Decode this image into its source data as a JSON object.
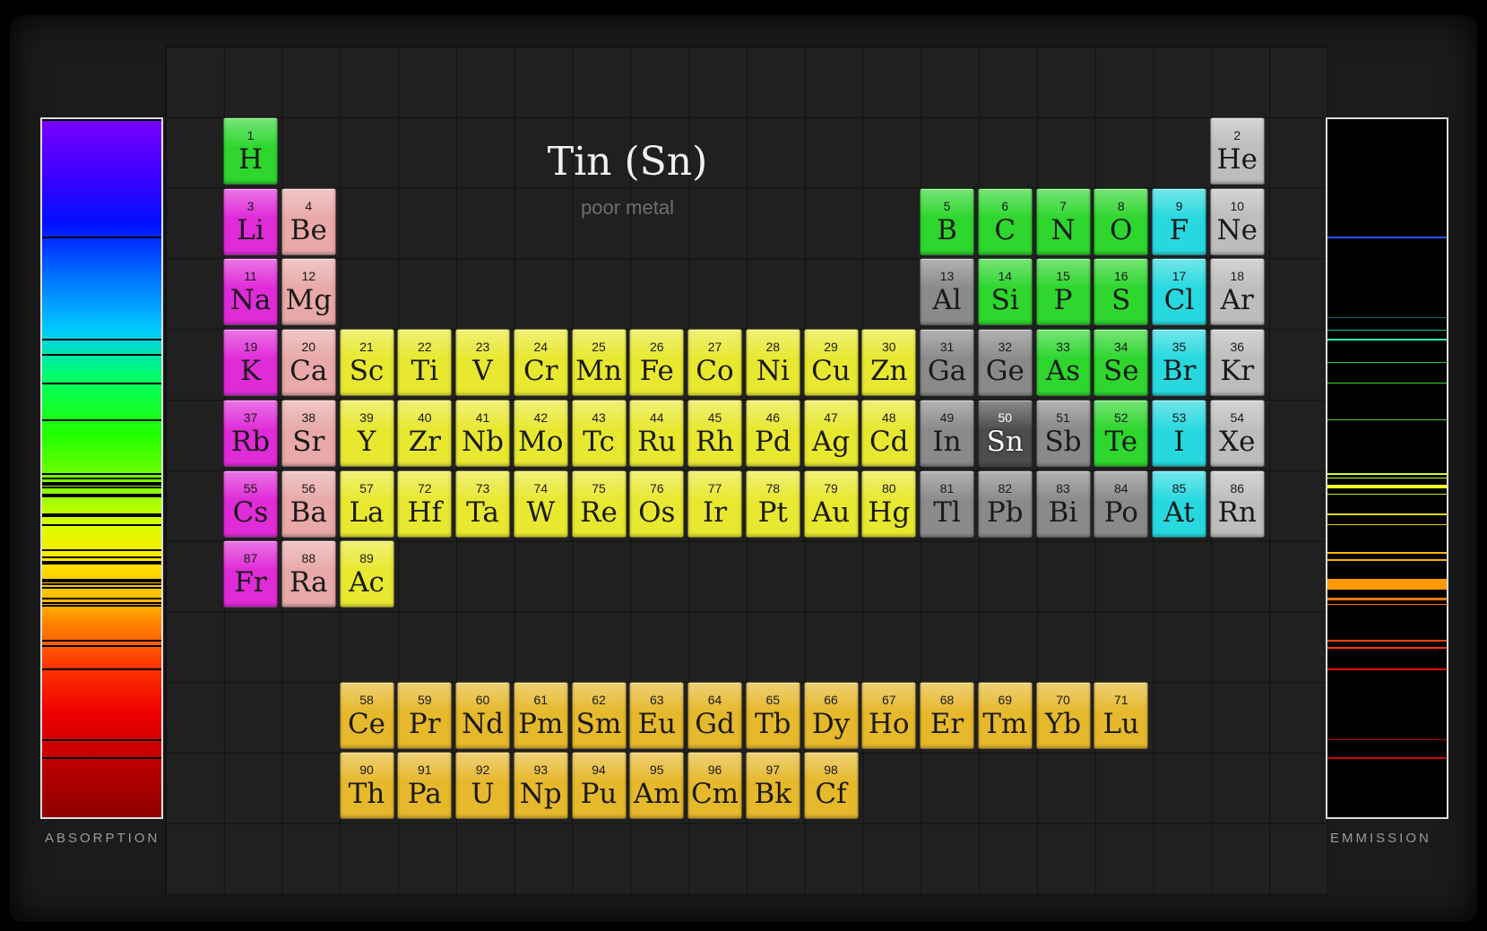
{
  "title": "Tin (Sn)",
  "subtitle": "poor metal",
  "absorption_label": "ABSORPTION",
  "emission_label": "EMMISSION",
  "colors": {
    "alkali": "#e02bd8",
    "alkaline": "#e8a9a8",
    "transition": "#e8e830",
    "nonmetal": "#2ed62e",
    "halogen": "#27d9df",
    "noble": "#bdbdbd",
    "poor": "#8a8a8a",
    "lanthanide": "#e6b82c",
    "actinide": "#e6b82c",
    "selected": "#4d4d4d"
  },
  "selected": "Sn",
  "elements": [
    {
      "n": "1",
      "s": "H",
      "t": "nonmetal",
      "r": 1,
      "c": 1
    },
    {
      "n": "2",
      "s": "He",
      "t": "noble",
      "r": 1,
      "c": 18
    },
    {
      "n": "3",
      "s": "Li",
      "t": "alkali",
      "r": 2,
      "c": 1
    },
    {
      "n": "4",
      "s": "Be",
      "t": "alkaline",
      "r": 2,
      "c": 2
    },
    {
      "n": "5",
      "s": "B",
      "t": "nonmetal",
      "r": 2,
      "c": 13
    },
    {
      "n": "6",
      "s": "C",
      "t": "nonmetal",
      "r": 2,
      "c": 14
    },
    {
      "n": "7",
      "s": "N",
      "t": "nonmetal",
      "r": 2,
      "c": 15
    },
    {
      "n": "8",
      "s": "O",
      "t": "nonmetal",
      "r": 2,
      "c": 16
    },
    {
      "n": "9",
      "s": "F",
      "t": "halogen",
      "r": 2,
      "c": 17
    },
    {
      "n": "10",
      "s": "Ne",
      "t": "noble",
      "r": 2,
      "c": 18
    },
    {
      "n": "11",
      "s": "Na",
      "t": "alkali",
      "r": 3,
      "c": 1
    },
    {
      "n": "12",
      "s": "Mg",
      "t": "alkaline",
      "r": 3,
      "c": 2
    },
    {
      "n": "13",
      "s": "Al",
      "t": "poor",
      "r": 3,
      "c": 13
    },
    {
      "n": "14",
      "s": "Si",
      "t": "nonmetal",
      "r": 3,
      "c": 14
    },
    {
      "n": "15",
      "s": "P",
      "t": "nonmetal",
      "r": 3,
      "c": 15
    },
    {
      "n": "16",
      "s": "S",
      "t": "nonmetal",
      "r": 3,
      "c": 16
    },
    {
      "n": "17",
      "s": "Cl",
      "t": "halogen",
      "r": 3,
      "c": 17
    },
    {
      "n": "18",
      "s": "Ar",
      "t": "noble",
      "r": 3,
      "c": 18
    },
    {
      "n": "19",
      "s": "K",
      "t": "alkali",
      "r": 4,
      "c": 1
    },
    {
      "n": "20",
      "s": "Ca",
      "t": "alkaline",
      "r": 4,
      "c": 2
    },
    {
      "n": "21",
      "s": "Sc",
      "t": "transition",
      "r": 4,
      "c": 3
    },
    {
      "n": "22",
      "s": "Ti",
      "t": "transition",
      "r": 4,
      "c": 4
    },
    {
      "n": "23",
      "s": "V",
      "t": "transition",
      "r": 4,
      "c": 5
    },
    {
      "n": "24",
      "s": "Cr",
      "t": "transition",
      "r": 4,
      "c": 6
    },
    {
      "n": "25",
      "s": "Mn",
      "t": "transition",
      "r": 4,
      "c": 7
    },
    {
      "n": "26",
      "s": "Fe",
      "t": "transition",
      "r": 4,
      "c": 8
    },
    {
      "n": "27",
      "s": "Co",
      "t": "transition",
      "r": 4,
      "c": 9
    },
    {
      "n": "28",
      "s": "Ni",
      "t": "transition",
      "r": 4,
      "c": 10
    },
    {
      "n": "29",
      "s": "Cu",
      "t": "transition",
      "r": 4,
      "c": 11
    },
    {
      "n": "30",
      "s": "Zn",
      "t": "transition",
      "r": 4,
      "c": 12
    },
    {
      "n": "31",
      "s": "Ga",
      "t": "poor",
      "r": 4,
      "c": 13
    },
    {
      "n": "32",
      "s": "Ge",
      "t": "poor",
      "r": 4,
      "c": 14
    },
    {
      "n": "33",
      "s": "As",
      "t": "nonmetal",
      "r": 4,
      "c": 15
    },
    {
      "n": "34",
      "s": "Se",
      "t": "nonmetal",
      "r": 4,
      "c": 16
    },
    {
      "n": "35",
      "s": "Br",
      "t": "halogen",
      "r": 4,
      "c": 17
    },
    {
      "n": "36",
      "s": "Kr",
      "t": "noble",
      "r": 4,
      "c": 18
    },
    {
      "n": "37",
      "s": "Rb",
      "t": "alkali",
      "r": 5,
      "c": 1
    },
    {
      "n": "38",
      "s": "Sr",
      "t": "alkaline",
      "r": 5,
      "c": 2
    },
    {
      "n": "39",
      "s": "Y",
      "t": "transition",
      "r": 5,
      "c": 3
    },
    {
      "n": "40",
      "s": "Zr",
      "t": "transition",
      "r": 5,
      "c": 4
    },
    {
      "n": "41",
      "s": "Nb",
      "t": "transition",
      "r": 5,
      "c": 5
    },
    {
      "n": "42",
      "s": "Mo",
      "t": "transition",
      "r": 5,
      "c": 6
    },
    {
      "n": "43",
      "s": "Tc",
      "t": "transition",
      "r": 5,
      "c": 7
    },
    {
      "n": "44",
      "s": "Ru",
      "t": "transition",
      "r": 5,
      "c": 8
    },
    {
      "n": "45",
      "s": "Rh",
      "t": "transition",
      "r": 5,
      "c": 9
    },
    {
      "n": "46",
      "s": "Pd",
      "t": "transition",
      "r": 5,
      "c": 10
    },
    {
      "n": "47",
      "s": "Ag",
      "t": "transition",
      "r": 5,
      "c": 11
    },
    {
      "n": "48",
      "s": "Cd",
      "t": "transition",
      "r": 5,
      "c": 12
    },
    {
      "n": "49",
      "s": "In",
      "t": "poor",
      "r": 5,
      "c": 13
    },
    {
      "n": "50",
      "s": "Sn",
      "t": "selected",
      "r": 5,
      "c": 14
    },
    {
      "n": "51",
      "s": "Sb",
      "t": "poor",
      "r": 5,
      "c": 15
    },
    {
      "n": "52",
      "s": "Te",
      "t": "nonmetal",
      "r": 5,
      "c": 16
    },
    {
      "n": "53",
      "s": "I",
      "t": "halogen",
      "r": 5,
      "c": 17
    },
    {
      "n": "54",
      "s": "Xe",
      "t": "noble",
      "r": 5,
      "c": 18
    },
    {
      "n": "55",
      "s": "Cs",
      "t": "alkali",
      "r": 6,
      "c": 1
    },
    {
      "n": "56",
      "s": "Ba",
      "t": "alkaline",
      "r": 6,
      "c": 2
    },
    {
      "n": "57",
      "s": "La",
      "t": "transition",
      "r": 6,
      "c": 3
    },
    {
      "n": "72",
      "s": "Hf",
      "t": "transition",
      "r": 6,
      "c": 4
    },
    {
      "n": "73",
      "s": "Ta",
      "t": "transition",
      "r": 6,
      "c": 5
    },
    {
      "n": "74",
      "s": "W",
      "t": "transition",
      "r": 6,
      "c": 6
    },
    {
      "n": "75",
      "s": "Re",
      "t": "transition",
      "r": 6,
      "c": 7
    },
    {
      "n": "76",
      "s": "Os",
      "t": "transition",
      "r": 6,
      "c": 8
    },
    {
      "n": "77",
      "s": "Ir",
      "t": "transition",
      "r": 6,
      "c": 9
    },
    {
      "n": "78",
      "s": "Pt",
      "t": "transition",
      "r": 6,
      "c": 10
    },
    {
      "n": "79",
      "s": "Au",
      "t": "transition",
      "r": 6,
      "c": 11
    },
    {
      "n": "80",
      "s": "Hg",
      "t": "transition",
      "r": 6,
      "c": 12
    },
    {
      "n": "81",
      "s": "Tl",
      "t": "poor",
      "r": 6,
      "c": 13
    },
    {
      "n": "82",
      "s": "Pb",
      "t": "poor",
      "r": 6,
      "c": 14
    },
    {
      "n": "83",
      "s": "Bi",
      "t": "poor",
      "r": 6,
      "c": 15
    },
    {
      "n": "84",
      "s": "Po",
      "t": "poor",
      "r": 6,
      "c": 16
    },
    {
      "n": "85",
      "s": "At",
      "t": "halogen",
      "r": 6,
      "c": 17
    },
    {
      "n": "86",
      "s": "Rn",
      "t": "noble",
      "r": 6,
      "c": 18
    },
    {
      "n": "87",
      "s": "Fr",
      "t": "alkali",
      "r": 7,
      "c": 1
    },
    {
      "n": "88",
      "s": "Ra",
      "t": "alkaline",
      "r": 7,
      "c": 2
    },
    {
      "n": "89",
      "s": "Ac",
      "t": "transition",
      "r": 7,
      "c": 3
    },
    {
      "n": "58",
      "s": "Ce",
      "t": "lanthanide",
      "r": 9,
      "c": 3
    },
    {
      "n": "59",
      "s": "Pr",
      "t": "lanthanide",
      "r": 9,
      "c": 4
    },
    {
      "n": "60",
      "s": "Nd",
      "t": "lanthanide",
      "r": 9,
      "c": 5
    },
    {
      "n": "61",
      "s": "Pm",
      "t": "lanthanide",
      "r": 9,
      "c": 6
    },
    {
      "n": "62",
      "s": "Sm",
      "t": "lanthanide",
      "r": 9,
      "c": 7
    },
    {
      "n": "63",
      "s": "Eu",
      "t": "lanthanide",
      "r": 9,
      "c": 8
    },
    {
      "n": "64",
      "s": "Gd",
      "t": "lanthanide",
      "r": 9,
      "c": 9
    },
    {
      "n": "65",
      "s": "Tb",
      "t": "lanthanide",
      "r": 9,
      "c": 10
    },
    {
      "n": "66",
      "s": "Dy",
      "t": "lanthanide",
      "r": 9,
      "c": 11
    },
    {
      "n": "67",
      "s": "Ho",
      "t": "lanthanide",
      "r": 9,
      "c": 12
    },
    {
      "n": "68",
      "s": "Er",
      "t": "lanthanide",
      "r": 9,
      "c": 13
    },
    {
      "n": "69",
      "s": "Tm",
      "t": "lanthanide",
      "r": 9,
      "c": 14
    },
    {
      "n": "70",
      "s": "Yb",
      "t": "lanthanide",
      "r": 9,
      "c": 15
    },
    {
      "n": "71",
      "s": "Lu",
      "t": "lanthanide",
      "r": 9,
      "c": 16
    },
    {
      "n": "90",
      "s": "Th",
      "t": "actinide",
      "r": 10,
      "c": 3
    },
    {
      "n": "91",
      "s": "Pa",
      "t": "actinide",
      "r": 10,
      "c": 4
    },
    {
      "n": "92",
      "s": "U",
      "t": "actinide",
      "r": 10,
      "c": 5
    },
    {
      "n": "93",
      "s": "Np",
      "t": "actinide",
      "r": 10,
      "c": 6
    },
    {
      "n": "94",
      "s": "Pu",
      "t": "actinide",
      "r": 10,
      "c": 7
    },
    {
      "n": "95",
      "s": "Am",
      "t": "actinide",
      "r": 10,
      "c": 8
    },
    {
      "n": "96",
      "s": "Cm",
      "t": "actinide",
      "r": 10,
      "c": 9
    },
    {
      "n": "97",
      "s": "Bk",
      "t": "actinide",
      "r": 10,
      "c": 10
    },
    {
      "n": "98",
      "s": "Cf",
      "t": "actinide",
      "r": 10,
      "c": 11
    }
  ]
}
